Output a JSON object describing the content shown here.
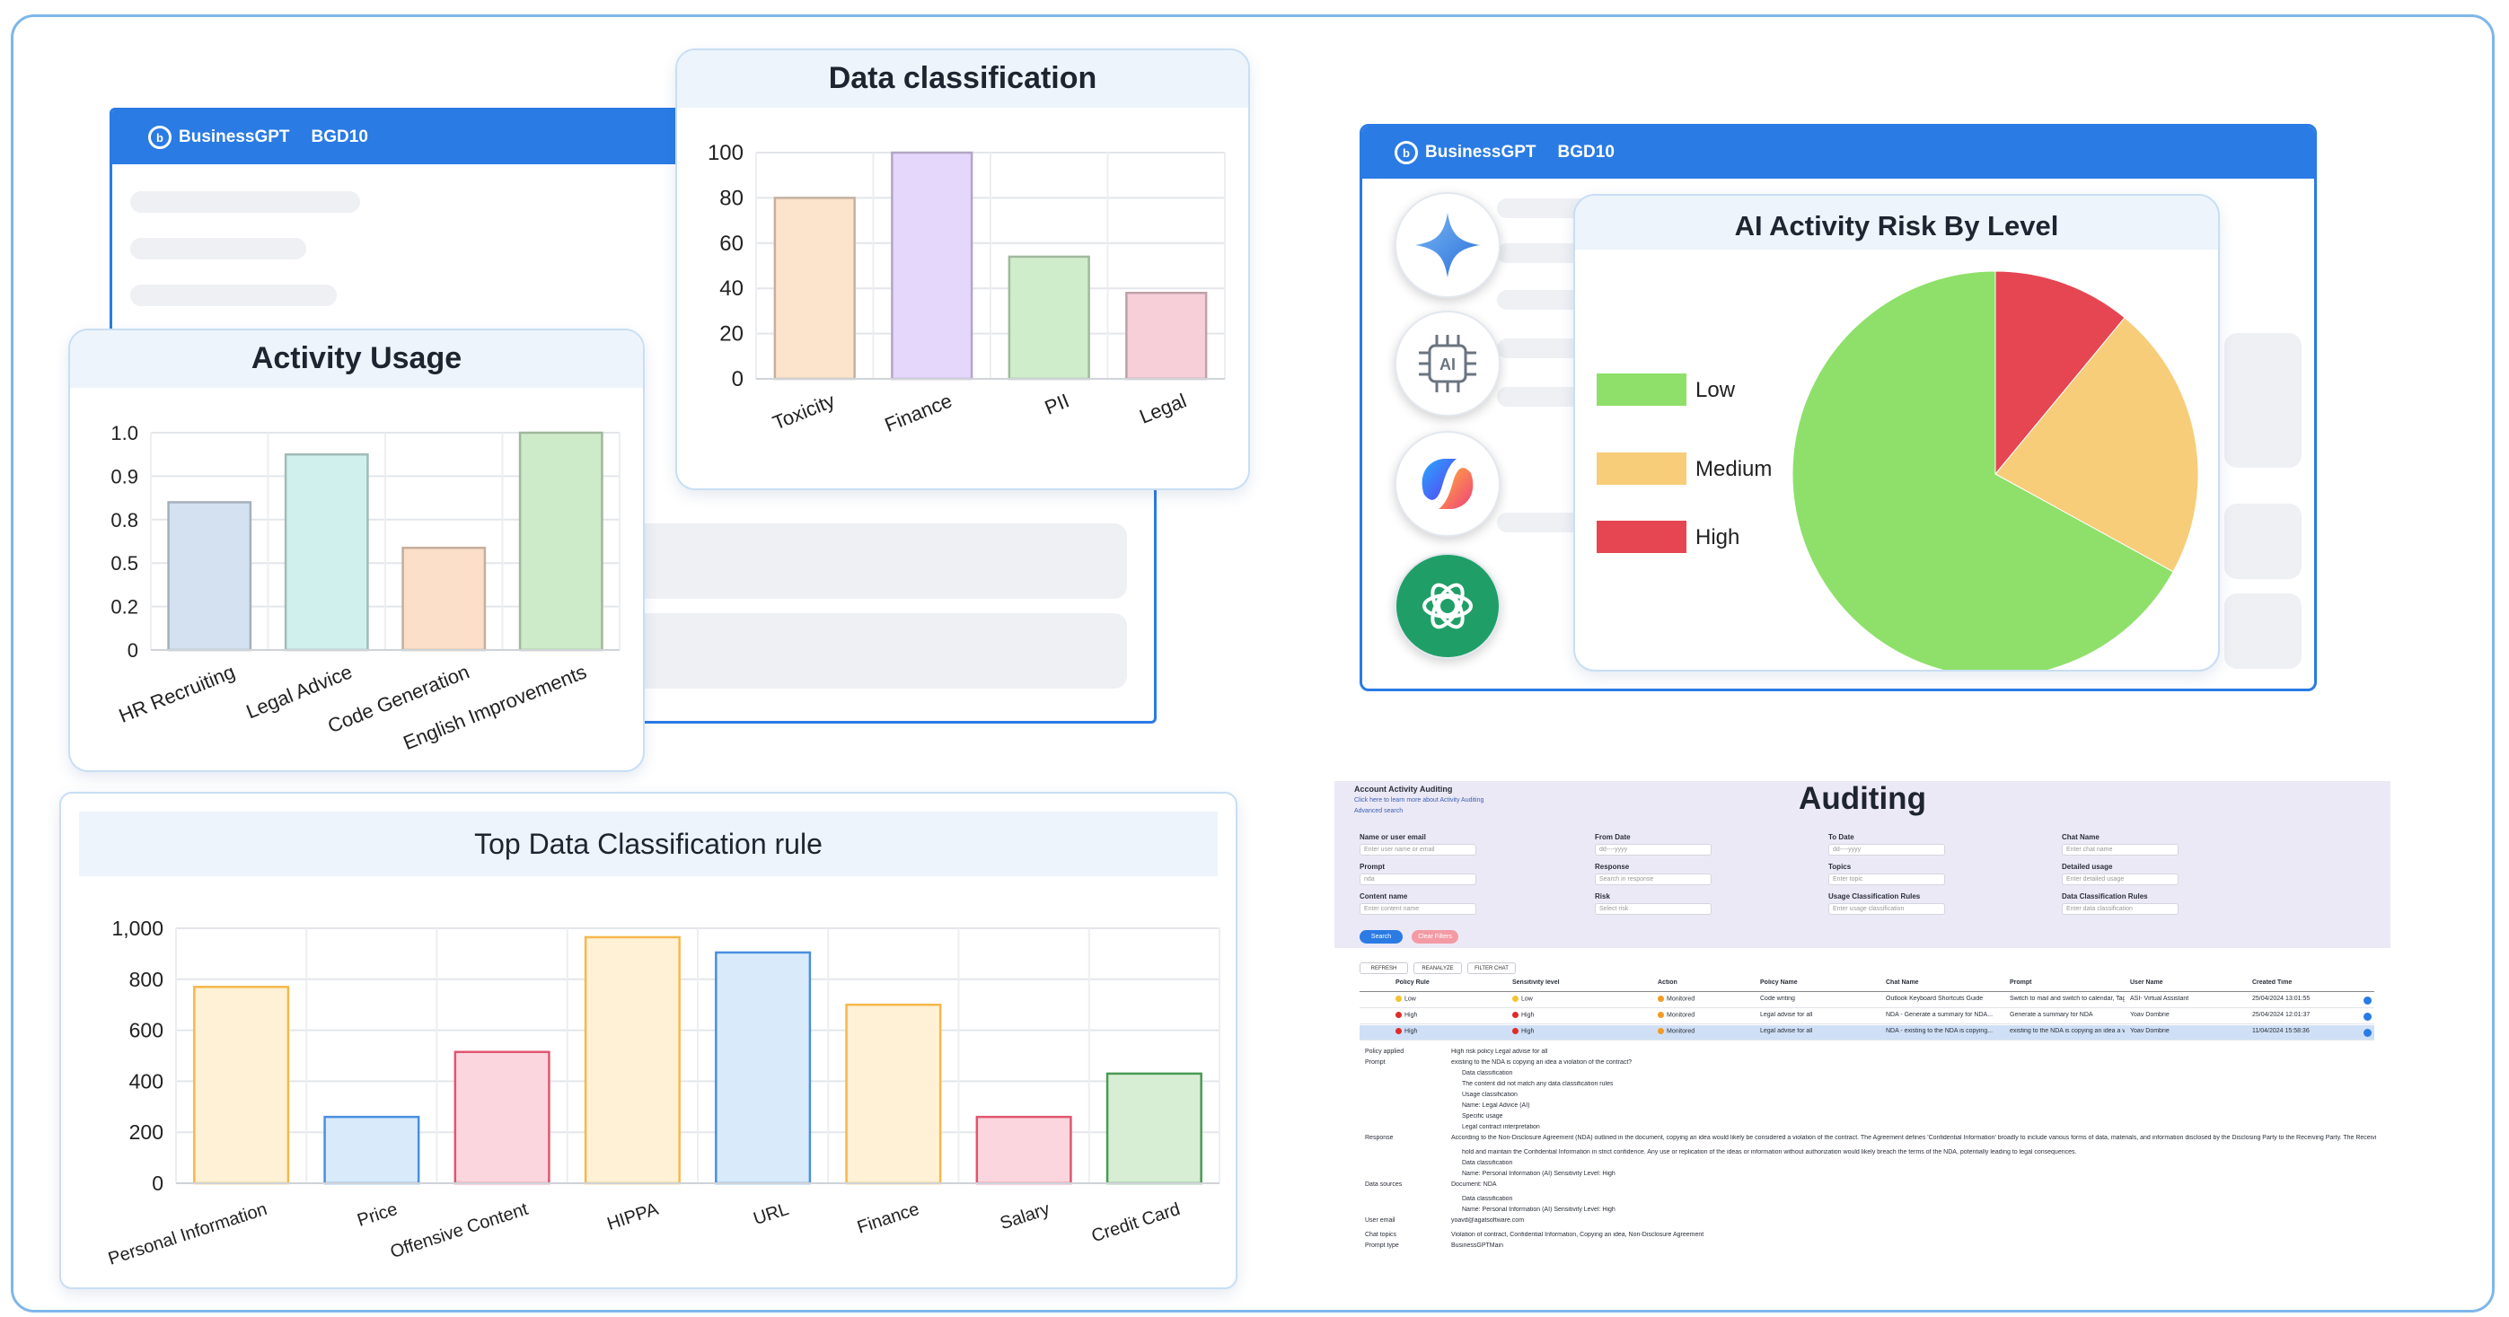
{
  "app": {
    "brand": "BusinessGPT",
    "workspace": "BGD10"
  },
  "icons": [
    "gemini-icon",
    "ai-chip-icon",
    "copilot-icon",
    "chatgpt-icon"
  ],
  "colors": {
    "frame_border": "#7fb6ea",
    "app_header": "#2a7be4",
    "low": "#8ee06a",
    "medium": "#f7cd7a",
    "high": "#e54652"
  },
  "activity_usage": {
    "title": "Activity Usage",
    "y_ticks": [
      "1.0",
      "0.9",
      "0.8",
      "0.5",
      "0.2",
      "0"
    ]
  },
  "data_classification": {
    "title": "Data classification"
  },
  "top_rule": {
    "title": "Top Data Classification rule"
  },
  "risk": {
    "title": "AI Activity Risk By Level",
    "legend": [
      "Low",
      "Medium",
      "High"
    ]
  },
  "chart_data": [
    {
      "type": "bar",
      "title": "Data classification",
      "categories": [
        "Toxicity",
        "Finance",
        "PII",
        "Legal"
      ],
      "values": [
        80,
        100,
        54,
        38
      ],
      "y_ticks": [
        "100",
        "80",
        "60",
        "40",
        "20",
        "0"
      ],
      "ylim": [
        0,
        100
      ],
      "colors": [
        "#fbe3cc",
        "#e5d6fb",
        "#cfeccb",
        "#f6cfd9"
      ],
      "grid": true
    },
    {
      "type": "bar",
      "title": "Activity Usage",
      "categories": [
        "HR Recruiting",
        "Legal Advice",
        "Code Generation",
        "English Improvements"
      ],
      "values": [
        0.68,
        0.9,
        0.47,
        1.0
      ],
      "y_ticks": [
        "1.0",
        "0.9",
        "0.8",
        "0.5",
        "0.2",
        "0"
      ],
      "colors": [
        "#d3e1f0",
        "#cff0ec",
        "#fbdfc8",
        "#cdebc8"
      ],
      "grid": true
    },
    {
      "type": "pie",
      "title": "AI Activity Risk By Level",
      "labels": [
        "Low",
        "Medium",
        "High"
      ],
      "values": [
        67,
        22,
        11
      ],
      "colors": [
        "#8ee06a",
        "#f7cd7a",
        "#e54652"
      ],
      "legend": "left"
    },
    {
      "type": "bar",
      "title": "Top Data Classification rule",
      "categories": [
        "Personal Information",
        "Price",
        "Offensive Content",
        "HIPPA",
        "URL",
        "Finance",
        "Salary",
        "Credit Card"
      ],
      "values": [
        770,
        260,
        515,
        965,
        905,
        700,
        260,
        430
      ],
      "y_ticks": [
        "1,000",
        "800",
        "600",
        "400",
        "200",
        "0"
      ],
      "ylim": [
        0,
        1000
      ],
      "colors": [
        "#fff1d6",
        "#d9ebfb",
        "#fbd6de",
        "#fff1d6",
        "#d9ebfb",
        "#fff1d6",
        "#fbd6de",
        "#d7eed5"
      ],
      "strokes": [
        "#f6b84a",
        "#4a8fe0",
        "#e05671",
        "#f6b84a",
        "#4a8fe0",
        "#f6b84a",
        "#e05671",
        "#4a9a55"
      ],
      "grid": true
    }
  ],
  "auditing": {
    "title": "Auditing",
    "header": "Account Activity Auditing",
    "help_link": "Click here to learn more about Activity Auditing",
    "advanced": "Advanced search",
    "fields": [
      {
        "label": "Name or user email",
        "placeholder": "Enter user name or email"
      },
      {
        "label": "From Date",
        "placeholder": "dd----yyyy"
      },
      {
        "label": "To Date",
        "placeholder": "dd----yyyy"
      },
      {
        "label": "Chat Name",
        "placeholder": "Enter chat name"
      },
      {
        "label": "Prompt",
        "placeholder": "nda"
      },
      {
        "label": "Response",
        "placeholder": "Search in response"
      },
      {
        "label": "Topics",
        "placeholder": "Enter topic"
      },
      {
        "label": "Detailed usage",
        "placeholder": "Enter detailed usage"
      },
      {
        "label": "Content name",
        "placeholder": "Enter content name"
      },
      {
        "label": "Risk",
        "placeholder": "Select risk"
      },
      {
        "label": "Usage Classification Rules",
        "placeholder": "Enter usage classification"
      },
      {
        "label": "Data Classification Rules",
        "placeholder": "Enter data classification"
      }
    ],
    "search_btn": "Search",
    "clear_btn": "Clear Filters",
    "toolbar": [
      "REFRESH",
      "REANALYZE",
      "FILTER CHAT"
    ],
    "columns": [
      "Policy Rule",
      "Sensitivity level",
      "Action",
      "Policy Name",
      "Chat Name",
      "Prompt",
      "User Name",
      "Created Time"
    ],
    "rows": [
      {
        "rule": "Low",
        "level": "Low",
        "action": "Monitored",
        "policy": "Code writing",
        "chat": "Outlook Keyboard Shortcuts Guide",
        "prompt": "Switch to mail and switch to calendar, Tag...",
        "user": "ASI- Virtual Assistant",
        "time": "25/04/2024 13:01:55"
      },
      {
        "rule": "High",
        "level": "High",
        "action": "Monitored",
        "policy": "Legal advise for all",
        "chat": "NDA - Generate a summary for NDA...",
        "prompt": "Generate a summary for NDA",
        "user": "Yoav Dombrie",
        "time": "25/04/2024 12:01:37"
      },
      {
        "rule": "High",
        "level": "High",
        "action": "Monitored",
        "policy": "Legal advise for all",
        "chat": "NDA - existing to the NDA is copying...",
        "prompt": "existing to the NDA is copying an idea a v...",
        "user": "Yoav Dombrie",
        "time": "11/04/2024 15:58:36"
      }
    ],
    "details": [
      {
        "k": "Policy applied",
        "v": "High risk policy Legal advise for all"
      },
      {
        "k": "Prompt",
        "v": "existing to the NDA is copying an idea a violation of the contract?"
      },
      {
        "k": "",
        "v": "Data classification"
      },
      {
        "k": "",
        "v": "The content did not match any data classification rules"
      },
      {
        "k": "",
        "v": "Usage classification"
      },
      {
        "k": "",
        "v": "Name: Legal Advice (AI)"
      },
      {
        "k": "",
        "v": "Specific usage"
      },
      {
        "k": "",
        "v": "Legal contract interpretation"
      },
      {
        "k": "Response",
        "v": "According to the Non-Disclosure Agreement (NDA) outlined in the document, copying an idea would likely be considered a violation of the contract. The Agreement defines 'Confidential Information' broadly to include various forms of data, materials, and information disclosed by the Disclosing Party to the Receiving Party. The Receiving Party is obligated to"
      },
      {
        "k": "",
        "v": "hold and maintain the Confidential Information in strict confidence. Any use or replication of the ideas or information without authorization would likely breach the terms of the NDA, potentially leading to legal consequences."
      },
      {
        "k": "",
        "v": "Data classification"
      },
      {
        "k": "",
        "v": "Name: Personal Information (AI)    Sensitivity Level: High"
      },
      {
        "k": "Data sources",
        "v": "Document: NDA"
      },
      {
        "k": "",
        "v": "Data classification"
      },
      {
        "k": "",
        "v": "Name: Personal Information (AI)    Sensitivity Level: High"
      },
      {
        "k": "User email",
        "v": "yoavd@agatsoftware.com"
      },
      {
        "k": "Chat topics",
        "v": "Violation of contract, Confidential Information, Copying an idea, Non-Disclosure Agreement"
      },
      {
        "k": "Prompt type",
        "v": "BusinessGPTMain"
      }
    ]
  }
}
